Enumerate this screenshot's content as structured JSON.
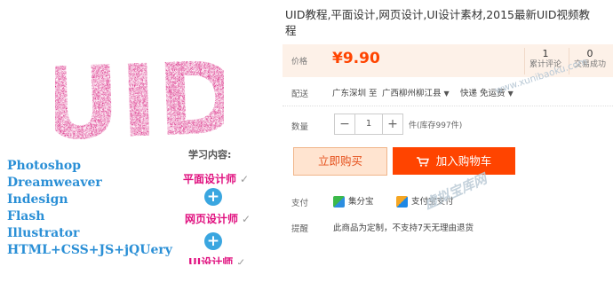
{
  "promo": {
    "logo_text": "UID",
    "skills": [
      "Photoshop",
      "Dreamweaver",
      "Indesign",
      "Flash",
      "Illustrator",
      "HTML+CSS+JS+jQUery"
    ],
    "learn_title": "学习内容:",
    "courses": [
      "平面设计师",
      "网页设计师",
      "UI设计师"
    ],
    "plus": "+",
    "check": "✓"
  },
  "product": {
    "title": "UID教程,平面设计,网页设计,UI设计素材,2015最新UID视频教程",
    "price_label": "价格",
    "price": "¥9.90",
    "sales_count": "1",
    "sales_label": "累计评论",
    "deals_count": "0",
    "deals_label": "交易成功",
    "shipping_label": "配送",
    "ship_from": "广东深圳 至",
    "ship_to": "广西柳州柳江县",
    "ship_method": "快递 免运费",
    "qty_label": "数量",
    "qty_minus": "−",
    "qty_value": "1",
    "qty_plus": "+",
    "stock_note": "件(库存997件)",
    "buy_now": "立即购买",
    "add_cart": "加入购物车",
    "pay_label": "支付",
    "pay_methods": [
      "集分宝",
      "支付宝支付"
    ],
    "notice_label": "提醒",
    "notice_text": "此商品为定制，不支持7天无理由退货"
  },
  "watermark": {
    "site": "www.xunibaoku.com",
    "name": "虚拟宝库网"
  }
}
